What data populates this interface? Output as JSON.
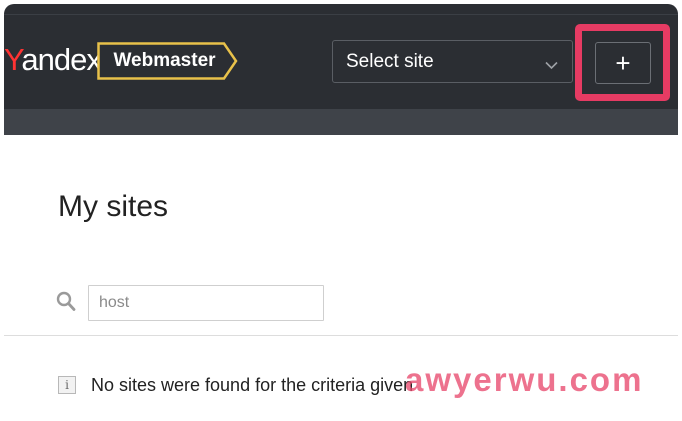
{
  "header": {
    "logo_first": "Y",
    "logo_rest": "andex",
    "product_label": "Webmaster",
    "site_select": {
      "label": "Select site",
      "icon": "chevron-down-icon"
    },
    "add_button": {
      "glyph": "+",
      "icon": "plus-icon"
    },
    "highlight_color": "#e63b63"
  },
  "main": {
    "title": "My sites",
    "search": {
      "placeholder": "host",
      "value": "",
      "icon": "search-icon"
    },
    "message": {
      "icon": "info-icon",
      "icon_glyph": "i",
      "text": "No sites were found for the criteria given"
    }
  },
  "watermark": "awyerwu.com",
  "colors": {
    "header_bg": "#2b2e33",
    "subbar_bg": "#3f4349",
    "badge_border": "#e8c14a",
    "logo_accent": "#ff3333"
  }
}
